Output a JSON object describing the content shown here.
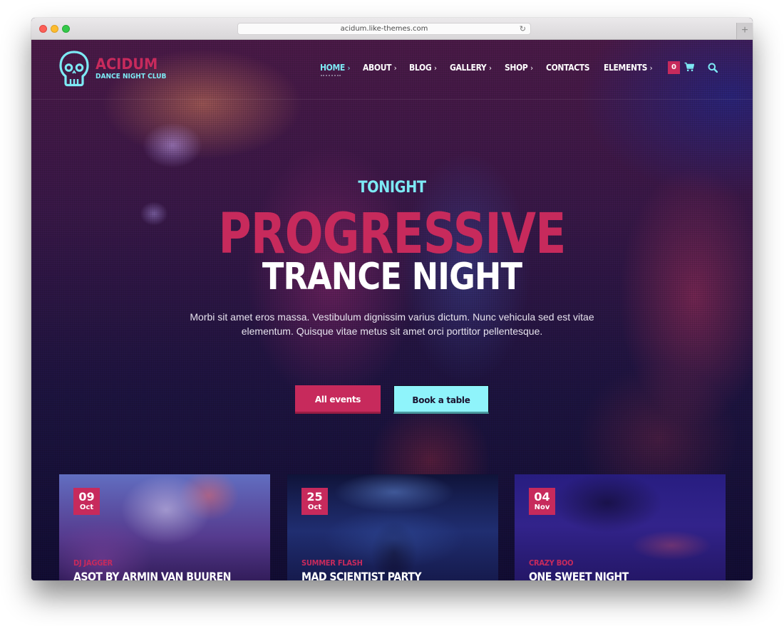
{
  "browser": {
    "url": "acidum.like-themes.com",
    "reload_icon": "reload-icon",
    "new_tab_icon": "plus-icon"
  },
  "logo": {
    "name": "ACIDUM",
    "tagline": "DANCE NIGHT CLUB",
    "icon": "skull-icon"
  },
  "nav": {
    "items": [
      {
        "label": "HOME",
        "has_submenu": true,
        "active": true
      },
      {
        "label": "ABOUT",
        "has_submenu": true,
        "active": false
      },
      {
        "label": "BLOG",
        "has_submenu": true,
        "active": false
      },
      {
        "label": "GALLERY",
        "has_submenu": true,
        "active": false
      },
      {
        "label": "SHOP",
        "has_submenu": true,
        "active": false
      },
      {
        "label": "CONTACTS",
        "has_submenu": false,
        "active": false
      },
      {
        "label": "ELEMENTS",
        "has_submenu": true,
        "active": false
      }
    ],
    "chevron": "›",
    "cart_count": "0",
    "cart_icon": "cart-icon",
    "search_icon": "search-icon"
  },
  "hero": {
    "kicker": "TONIGHT",
    "title_line1": "PROGRESSIVE",
    "title_line2": "TRANCE NIGHT",
    "description": "Morbi sit amet eros massa. Vestibulum dignissim varius dictum. Nunc vehicula sed est vitae elementum. Quisque vitae metus sit amet orci porttitor pellentesque.",
    "buttons": {
      "primary": "All events",
      "secondary": "Book a table"
    }
  },
  "events": [
    {
      "day": "09",
      "month": "Oct",
      "dj": "DJ JAGGER",
      "title": "ASOT BY ARMIN VAN BUUREN"
    },
    {
      "day": "25",
      "month": "Oct",
      "dj": "SUMMER FLASH",
      "title": "MAD SCIENTIST PARTY"
    },
    {
      "day": "04",
      "month": "Nov",
      "dj": "CRAZY BOO",
      "title": "ONE SWEET NIGHT"
    }
  ],
  "colors": {
    "accent_pink": "#c72a5c",
    "accent_cyan": "#7de9f4",
    "button_cyan": "#8ff4fb",
    "background_dark": "#120c2e"
  }
}
